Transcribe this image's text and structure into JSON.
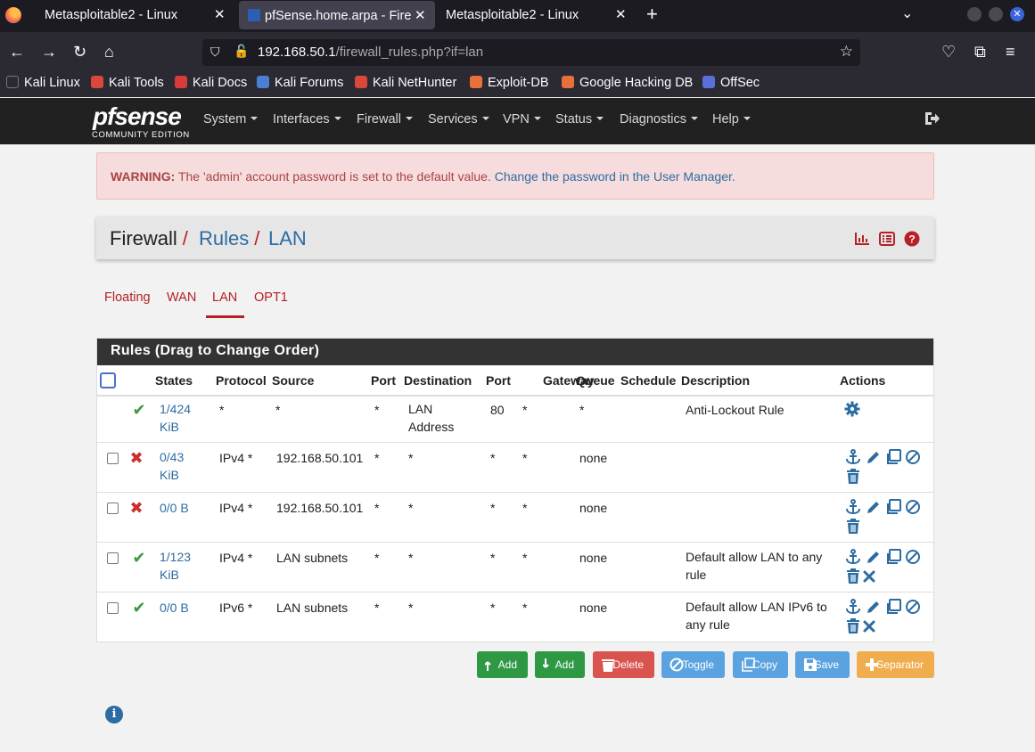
{
  "browser": {
    "tabs": [
      {
        "title": "Metasploitable2 - Linux",
        "active": false
      },
      {
        "title": "pfSense.home.arpa - Fire",
        "active": true
      },
      {
        "title": "Metasploitable2 - Linux",
        "active": false
      }
    ],
    "url_host": "192.168.50.1",
    "url_path": "/firewall_rules.php?if=lan",
    "bookmarks": [
      "Kali Linux",
      "Kali Tools",
      "Kali Docs",
      "Kali Forums",
      "Kali NetHunter",
      "Exploit-DB",
      "Google Hacking DB",
      "OffSec"
    ]
  },
  "pfsense": {
    "logo_text": "pfsense",
    "logo_sub": "COMMUNITY EDITION",
    "menu": [
      "System",
      "Interfaces",
      "Firewall",
      "Services",
      "VPN",
      "Status",
      "Diagnostics",
      "Help"
    ]
  },
  "warning": {
    "label": "WARNING:",
    "text": "The 'admin' account password is set to the default value.",
    "link": "Change the password in the User Manager."
  },
  "breadcrumb": {
    "items": [
      "Firewall",
      "Rules",
      "LAN"
    ],
    "sep": "/"
  },
  "iface_tabs": [
    "Floating",
    "WAN",
    "LAN",
    "OPT1"
  ],
  "active_tab": "LAN",
  "rules": {
    "title": "Rules (Drag to Change Order)",
    "columns": [
      "States",
      "Protocol",
      "Source",
      "Port",
      "Destination",
      "Port",
      "Gateway",
      "Queue",
      "Schedule",
      "Description",
      "Actions"
    ],
    "rows": [
      {
        "states_a": "1/424",
        "states_b": "KiB",
        "protocol": "*",
        "source": "*",
        "sport": "*",
        "dest_a": "LAN",
        "dest_b": "Address",
        "dport": "80",
        "gateway": "*",
        "queue": "*",
        "schedule": "",
        "desc_a": "Anti-Lockout Rule",
        "desc_b": "",
        "status": "pass"
      },
      {
        "states_a": "0/43",
        "states_b": "KiB",
        "protocol": "IPv4 *",
        "source": "192.168.50.101",
        "sport": "*",
        "dest_a": "*",
        "dest_b": "",
        "dport": "*",
        "gateway": "*",
        "queue": "none",
        "schedule": "",
        "desc_a": "",
        "desc_b": "",
        "status": "block"
      },
      {
        "states_a": "0/0 B",
        "states_b": "",
        "protocol": "IPv4 *",
        "source": "192.168.50.101",
        "sport": "*",
        "dest_a": "*",
        "dest_b": "",
        "dport": "*",
        "gateway": "*",
        "queue": "none",
        "schedule": "",
        "desc_a": "",
        "desc_b": "",
        "status": "block"
      },
      {
        "states_a": "1/123",
        "states_b": "KiB",
        "protocol": "IPv4 *",
        "source": "LAN subnets",
        "sport": "*",
        "dest_a": "*",
        "dest_b": "",
        "dport": "*",
        "gateway": "*",
        "queue": "none",
        "schedule": "",
        "desc_a": "Default allow LAN to any",
        "desc_b": "rule",
        "status": "pass"
      },
      {
        "states_a": "0/0 B",
        "states_b": "",
        "protocol": "IPv6 *",
        "source": "LAN subnets",
        "sport": "*",
        "dest_a": "*",
        "dest_b": "",
        "dport": "*",
        "gateway": "*",
        "queue": "none",
        "schedule": "",
        "desc_a": "Default allow LAN IPv6 to",
        "desc_b": "any rule",
        "status": "pass"
      }
    ]
  },
  "buttons": {
    "add_top": "Add",
    "add_bottom": "Add",
    "delete": "Delete",
    "toggle": "Toggle",
    "copy": "Copy",
    "save": "Save",
    "separator": "Separator"
  },
  "colors": {
    "brand_red": "#b52126",
    "link_blue": "#2d6ca2",
    "pass_green": "#3c9a3c",
    "block_red": "#c9302c"
  }
}
